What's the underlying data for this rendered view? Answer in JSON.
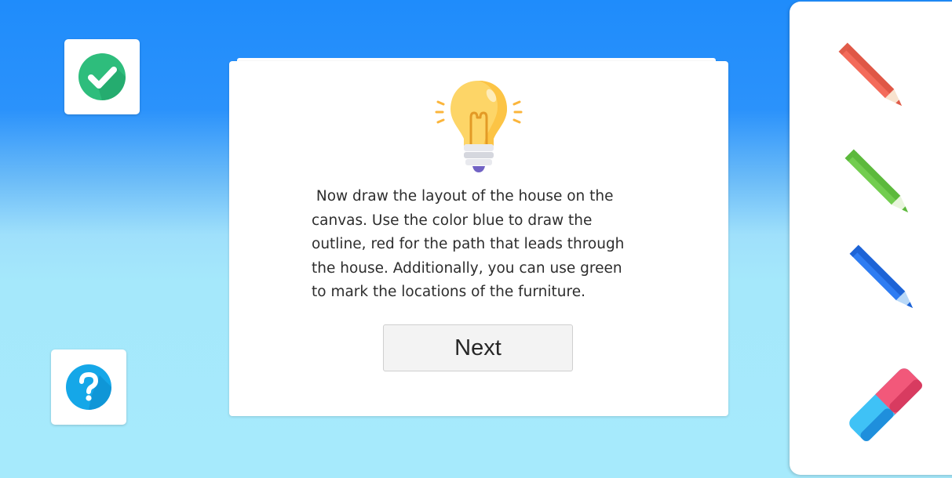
{
  "actions": {
    "check_icon": "check-circle-icon",
    "help_icon": "question-circle-icon"
  },
  "dialog": {
    "icon": "lightbulb-icon",
    "message": " Now draw the layout of the house on the\ncanvas. Use the color blue to draw the\noutline, red for the path that leads through\nthe house. Additionally, you can use green\nto mark the locations of the furniture.",
    "next_label": "Next"
  },
  "toolbox": {
    "tools": [
      {
        "name": "red-pencil",
        "icon": "pencil-icon",
        "color": "#f36b5a"
      },
      {
        "name": "green-pencil",
        "icon": "pencil-icon",
        "color": "#72cd4f"
      },
      {
        "name": "blue-pencil",
        "icon": "pencil-icon",
        "color": "#2e7cf2"
      },
      {
        "name": "eraser",
        "icon": "eraser-icon",
        "colors": [
          "#f2587a",
          "#3fc2f6"
        ]
      }
    ]
  },
  "colors": {
    "background_top": "#1f8cfb",
    "background_bottom": "#a6eafc",
    "check_green": "#2ebd7c",
    "help_blue": "#15a7e8",
    "bulb_yellow": "#fdd567"
  }
}
